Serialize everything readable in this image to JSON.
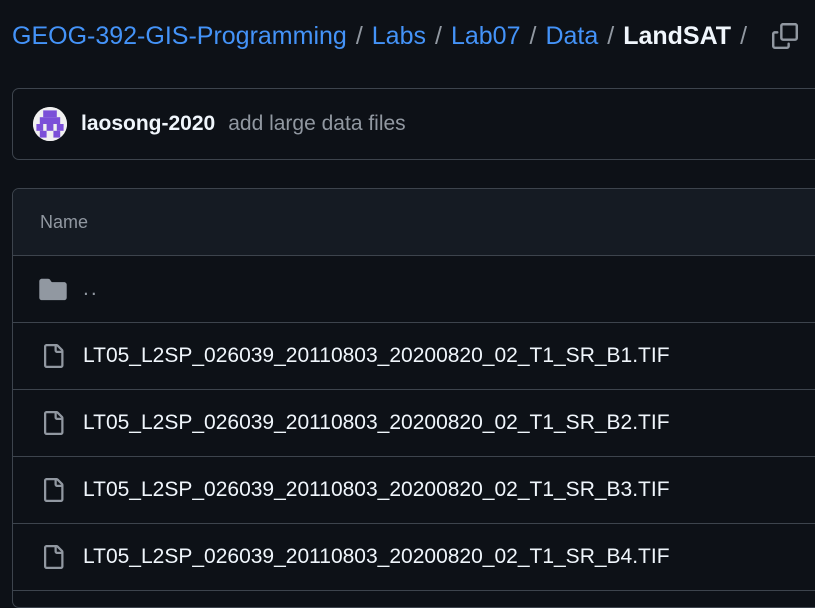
{
  "breadcrumb": {
    "items": [
      "GEOG-392-GIS-Programming",
      "Labs",
      "Lab07",
      "Data"
    ],
    "current": "LandSAT",
    "separator": "/"
  },
  "icons": {
    "copy": "copy-icon",
    "avatar": "avatar-identicon",
    "folder": "folder-icon",
    "file": "file-icon"
  },
  "commit": {
    "author": "laosong-2020",
    "message": "add large data files"
  },
  "table": {
    "header": "Name",
    "parent_row": "..",
    "files": [
      "LT05_L2SP_026039_20110803_20200820_02_T1_SR_B1.TIF",
      "LT05_L2SP_026039_20110803_20200820_02_T1_SR_B2.TIF",
      "LT05_L2SP_026039_20110803_20200820_02_T1_SR_B3.TIF",
      "LT05_L2SP_026039_20110803_20200820_02_T1_SR_B4.TIF"
    ]
  },
  "colors": {
    "background": "#0d1117",
    "link": "#4493f8",
    "border": "#3d444d",
    "muted": "#9198a1",
    "avatar_accent": "#7b4fd8"
  }
}
